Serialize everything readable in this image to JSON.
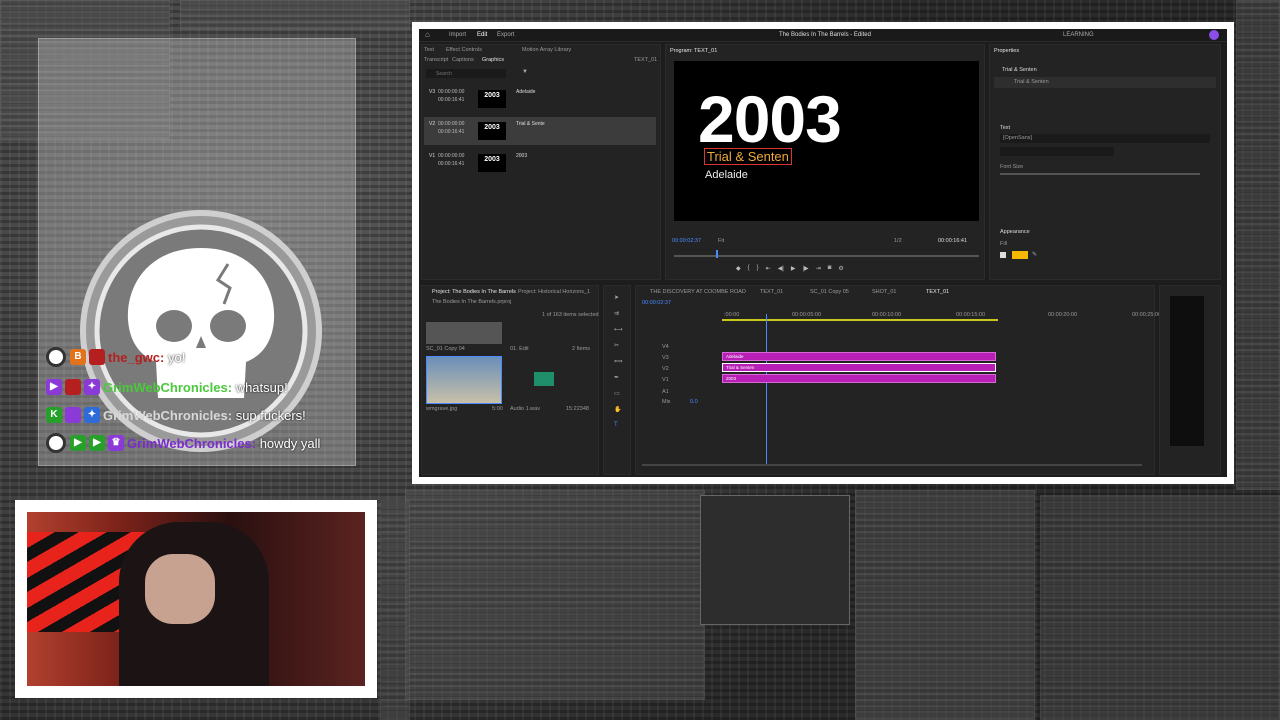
{
  "chat": {
    "messages": [
      {
        "user": "the_gwc:",
        "text": "yo!",
        "user_color": "#b51f1f"
      },
      {
        "user": "GrimWebChronicles:",
        "text": "whatsup!",
        "user_color": "#4bc93c"
      },
      {
        "user": "GrimWebChronicles:",
        "text": "sup fuckers!",
        "user_color": "#d8d8d8"
      },
      {
        "user": "GrimWebChronicles:",
        "text": "howdy yall",
        "user_color": "#7a2ccc"
      }
    ]
  },
  "premiere": {
    "topbar": {
      "home": "⌂",
      "import": "Import",
      "edit": "Edit",
      "export": "Export",
      "project_title": "The Bodies In The Barrels - Edited",
      "learning": "LEARNING"
    },
    "graphics_panel": {
      "tabs": [
        "Transcript",
        "Captions",
        "Graphics"
      ],
      "subtabs": [
        "Text",
        "Effect Controls",
        "Motion Array Library"
      ],
      "sequence_label": "TEXT_01",
      "search_placeholder": "Search",
      "layers": [
        {
          "track": "V3",
          "tc_in": "00:00:00:00",
          "tc_out": "00:00:16:41",
          "thumb": "2003",
          "name": "Adelaide"
        },
        {
          "track": "V2",
          "tc_in": "00:00:00:00",
          "tc_out": "00:00:16:41",
          "thumb": "2003",
          "name": "Trial & Sente"
        },
        {
          "track": "V1",
          "tc_in": "00:00:00:00",
          "tc_out": "00:00:16:41",
          "thumb": "2003",
          "name": "2003"
        }
      ]
    },
    "program": {
      "title": "Program: TEXT_01",
      "big_text": "2003",
      "subtitle": "Trial & Senten",
      "place": "Adelaide",
      "timecode": "00:00:02:37",
      "fit": "Fit",
      "quality": "1/2",
      "duration": "00:00:16:41"
    },
    "properties": {
      "title": "Properties",
      "layer_name": "Trial & Senten",
      "text_item": "Trial & Senten",
      "text_section": "Text",
      "font": "[OpenSans]",
      "font_size_label": "Font Size",
      "appearance": "Appearance",
      "fill": "Fill",
      "fill_color": "#f5b800"
    },
    "project": {
      "tabs": [
        "Project: The Bodies In The Barrels",
        "Project: Historical Horizons_1"
      ],
      "file": "The Bodies In The Barrels.prproj",
      "selection": "1 of 163 items selected",
      "items": [
        {
          "name": "SC_01 Copy 04",
          "meta": "01. Edit",
          "extra": "2 Items"
        },
        {
          "name": "wmgrave.jpg",
          "meta": "5:00"
        },
        {
          "name": "Audio 1.wav",
          "meta": "15:22348"
        }
      ]
    },
    "timeline": {
      "tabs": [
        "THE DISCOVERY AT COOMBE ROAD",
        "TEXT_01",
        "SC_01 Copy 05",
        "SHOT_01",
        "TEXT_01"
      ],
      "timecode": "00:00:02:37",
      "ruler": [
        ":00:00",
        "00:00:05:00",
        "00:00:10:00",
        "00:00:15:00",
        "00:00:20:00",
        "00:00:25:00"
      ],
      "tracks": [
        "V4",
        "V3",
        "V2",
        "V1",
        "A1",
        "Mix"
      ],
      "mix_value": "0.0",
      "clips": [
        "Adelaide",
        "Trial & Senten",
        "2003"
      ]
    }
  }
}
